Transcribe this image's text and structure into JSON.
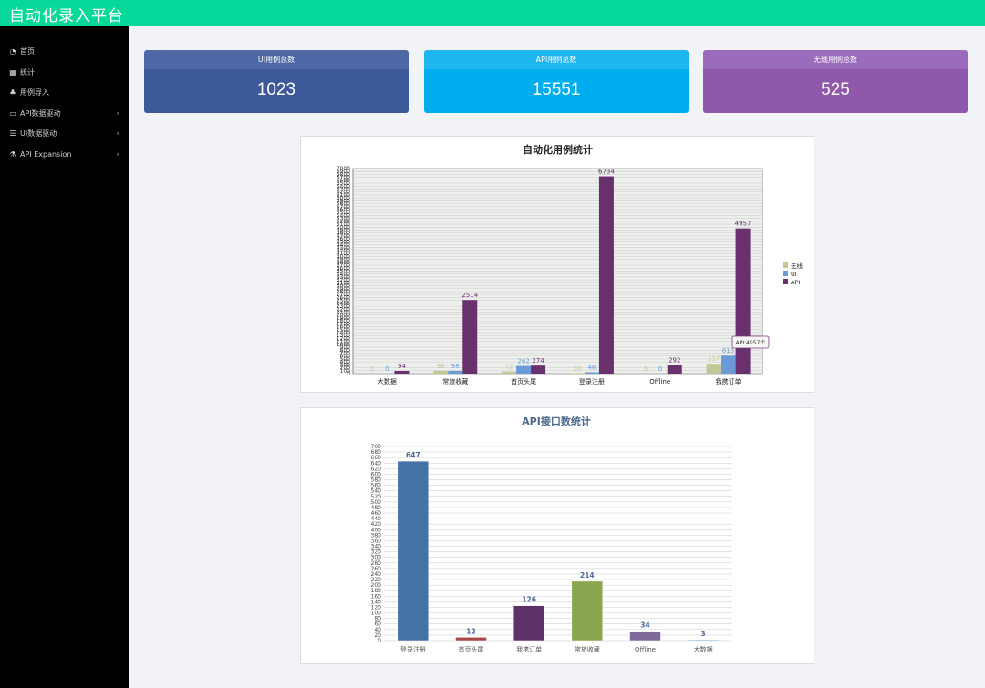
{
  "app": {
    "title": "自动化录入平台"
  },
  "sidebar": {
    "items": [
      {
        "label": "首页",
        "icon": "dashboard-icon"
      },
      {
        "label": "统计",
        "icon": "table-icon"
      },
      {
        "label": "用例导入",
        "icon": "sitemap-icon"
      },
      {
        "label": "API数据驱动",
        "icon": "laptop-icon",
        "chevron": "‹"
      },
      {
        "label": "UI数据驱动",
        "icon": "list-icon",
        "chevron": "‹"
      },
      {
        "label": "API Expansion",
        "icon": "flask-icon",
        "chevron": "‹"
      }
    ]
  },
  "cards": [
    {
      "label": "UI用例总数",
      "value": "1023",
      "head_color": "#4e68a5",
      "body_color": "#3c5a9a"
    },
    {
      "label": "API用例总数",
      "value": "15551",
      "head_color": "#1fb5ee",
      "body_color": "#00adee"
    },
    {
      "label": "无线用例总数",
      "value": "525",
      "head_color": "#9b6bbc",
      "body_color": "#8f58aa"
    }
  ],
  "chart_data": [
    {
      "type": "bar",
      "title": "自动化用例统计",
      "categories": [
        "大数据",
        "常旅收藏",
        "首页头尾",
        "登录注册",
        "Offline",
        "我携订单"
      ],
      "series": [
        {
          "name": "无线",
          "color": "#c2c795",
          "values": [
            0,
            96,
            72,
            20,
            0,
            337
          ]
        },
        {
          "name": "UI",
          "color": "#6a9bd8",
          "values": [
            0,
            98,
            262,
            48,
            0,
            615
          ]
        },
        {
          "name": "API",
          "color": "#68306d",
          "values": [
            94,
            2514,
            274,
            6734,
            292,
            4957
          ]
        }
      ],
      "ylim": [
        0,
        7000
      ],
      "grid": true,
      "legend": "right",
      "tooltip": "API:4957个"
    },
    {
      "type": "bar",
      "title": "API接口数统计",
      "categories": [
        "登录注册",
        "首页头尾",
        "我携订单",
        "常旅收藏",
        "Offline",
        "大数据"
      ],
      "values": [
        647,
        12,
        126,
        214,
        34,
        3
      ],
      "colors": [
        "#4572a7",
        "#aa4643",
        "#5e3268",
        "#89a54e",
        "#80699b",
        "#3d96ae"
      ],
      "ylim": [
        0,
        700
      ],
      "yticks_step": 20,
      "grid": true
    }
  ]
}
